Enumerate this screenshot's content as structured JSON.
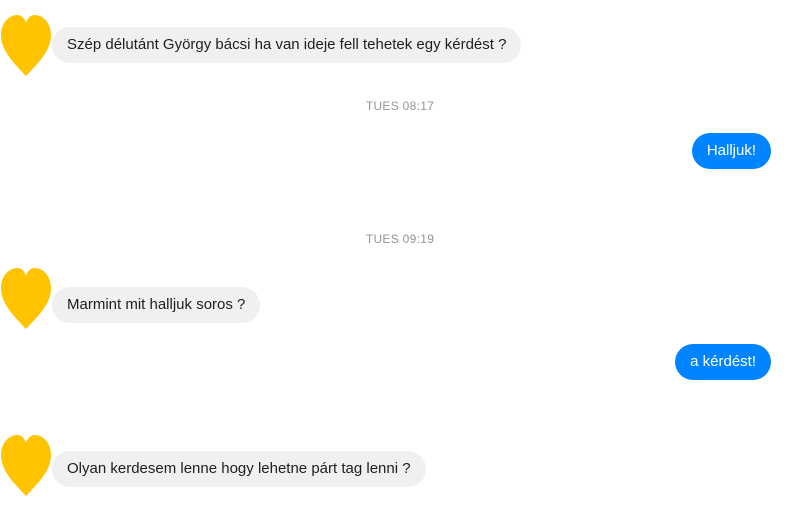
{
  "conversation": {
    "messages": [
      {
        "sender": "other",
        "text": "Szép délutánt György bácsi ha van ideje fell tehetek egy kérdést ?"
      },
      {
        "sender": "me",
        "text": "Halljuk!"
      },
      {
        "sender": "other",
        "text": "Marmint mit halljuk soros ?"
      },
      {
        "sender": "me",
        "text": "a kérdést!"
      },
      {
        "sender": "other",
        "text": "Olyan kerdesem lenne hogy lehetne párt tag lenni ?"
      }
    ],
    "timestamps": [
      "TUES 08:17",
      "TUES 09:19"
    ]
  },
  "theme": {
    "incoming_bubble": "#f1f0f0",
    "outgoing_bubble": "#0084ff",
    "avatar_color": "#ffc300"
  },
  "icons": {
    "avatar": "yellow-heart-icon"
  }
}
